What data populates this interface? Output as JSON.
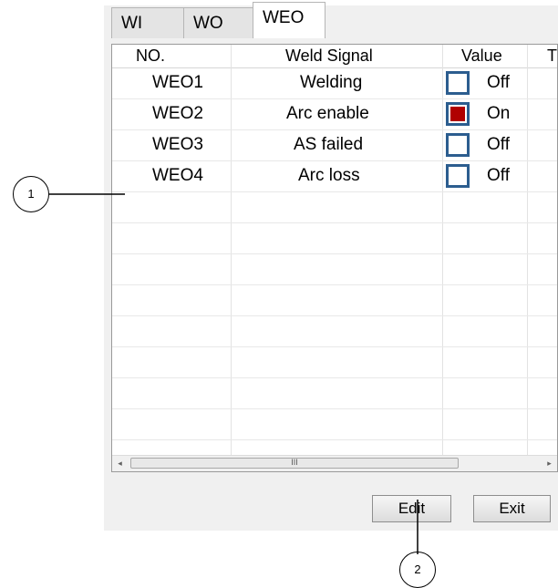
{
  "tabs": [
    {
      "label": "WI"
    },
    {
      "label": "WO"
    },
    {
      "label": "WEO"
    }
  ],
  "table": {
    "columns": [
      "NO.",
      "Weld Signal",
      "Value",
      "T"
    ],
    "rows": [
      {
        "no": "WEO1",
        "signal": "Welding",
        "value": "Off",
        "on": false
      },
      {
        "no": "WEO2",
        "signal": "Arc enable",
        "value": "On",
        "on": true
      },
      {
        "no": "WEO3",
        "signal": "AS failed",
        "value": "Off",
        "on": false
      },
      {
        "no": "WEO4",
        "signal": "Arc loss",
        "value": "Off",
        "on": false
      }
    ]
  },
  "scrollbar": {
    "thumb_grip": "III",
    "left_arrow": "◂",
    "right_arrow": "▸"
  },
  "buttons": {
    "edit": "Edit",
    "exit": "Exit"
  },
  "callouts": {
    "one": "1",
    "two": "2"
  },
  "colors": {
    "checkbox_border": "#2c5d8f",
    "checkbox_on": "#b00000"
  }
}
